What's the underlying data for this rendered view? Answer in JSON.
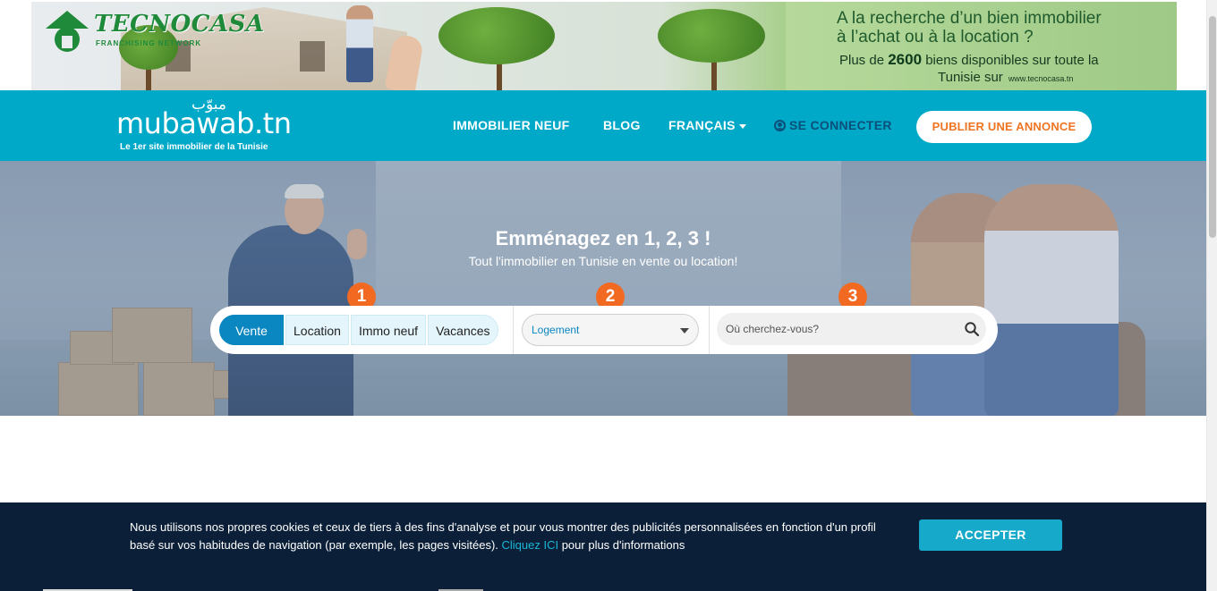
{
  "banner": {
    "logo_text": "TECNOCASA",
    "logo_sub": "FRANCHISING NETWORK",
    "headline_line1": "A la recherche d’un bien immobilier",
    "headline_line2": "à l’achat ou à la location ?",
    "body_prefix": "Plus de ",
    "body_number": "2600",
    "body_suffix": " biens disponibles sur toute la",
    "body_line2": "Tunisie sur",
    "url": "www.tecnocasa.tn",
    "logo_color": "#1f8a3a"
  },
  "header": {
    "brand_arabic": "مبوّب",
    "brand_name": "mubawab.tn",
    "brand_tagline": "Le 1er site immobilier de la Tunisie",
    "nav": {
      "immobilier_neuf": "IMMOBILIER NEUF",
      "blog": "BLOG",
      "language": "FRANÇAIS",
      "login": "SE CONNECTER"
    },
    "publish_button": "PUBLIER UNE ANNONCE",
    "bg_color": "#00a9c8",
    "accent_color": "#f07422"
  },
  "hero": {
    "title": "Emménagez en 1, 2, 3 !",
    "subtitle": "Tout l'immobilier en Tunisie en vente ou location!",
    "steps": [
      "1",
      "2",
      "3"
    ],
    "tabs": [
      "Vente",
      "Location",
      "Immo neuf",
      "Vacances"
    ],
    "active_tab": "Vente",
    "property_type": "Logement",
    "location_placeholder": "Où cherchez-vous?",
    "step_color": "#f26a21"
  },
  "cookie": {
    "text_before": "Nous utilisons nos propres cookies et ceux de tiers à des fins d'analyse et pour vous montrer des publicités personnalisées en fonction d'un profil basé sur vos habitudes de navigation (par exemple, les pages visitées). ",
    "link": "Cliquez ICI",
    "text_after": " pour plus d'informations",
    "accept_button": "ACCEPTER",
    "bg_color": "#0b2038"
  }
}
